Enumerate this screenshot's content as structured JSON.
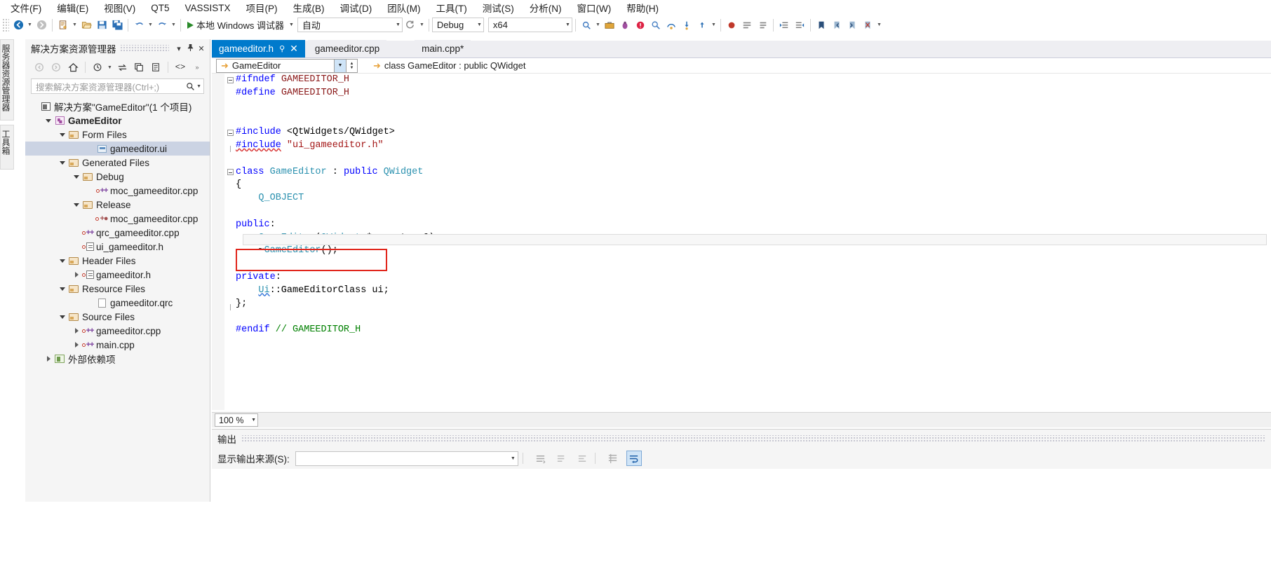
{
  "menubar": {
    "items": [
      {
        "label": "文件(F)"
      },
      {
        "label": "编辑(E)"
      },
      {
        "label": "视图(V)"
      },
      {
        "label": "QT5"
      },
      {
        "label": "VASSISTX"
      },
      {
        "label": "项目(P)"
      },
      {
        "label": "生成(B)"
      },
      {
        "label": "调试(D)"
      },
      {
        "label": "团队(M)"
      },
      {
        "label": "工具(T)"
      },
      {
        "label": "测试(S)"
      },
      {
        "label": "分析(N)"
      },
      {
        "label": "窗口(W)"
      },
      {
        "label": "帮助(H)"
      }
    ]
  },
  "toolbar": {
    "back_icon": "back-arrow-icon",
    "forward_icon": "forward-arrow-icon",
    "new_project_icon": "new-project-icon",
    "open_file_icon": "open-file-icon",
    "save_icon": "save-icon",
    "save_all_icon": "save-all-icon",
    "undo_icon": "undo-icon",
    "redo_icon": "redo-icon",
    "run_label": "本地 Windows 调试器",
    "run_icon": "play-icon",
    "config_auto": "自动",
    "restart_icon": "restart-icon",
    "config_debug": "Debug",
    "config_platform": "x64",
    "right_icons": [
      "find-icon",
      "toolbox-icon",
      "bug-icon",
      "error-list-icon",
      "find-in-files-icon",
      "step-over-icon",
      "step-into-icon",
      "step-out-icon",
      "breakpoint-icon",
      "comment-icon",
      "uncomment-icon",
      "indent-icon",
      "outdent-icon",
      "bookmark-icon",
      "prev-bookmark-icon",
      "next-bookmark-icon",
      "clear-bookmarks-icon"
    ]
  },
  "left_vertical_tabs": [
    {
      "label": "服务器资源管理器"
    },
    {
      "label": "工具箱"
    }
  ],
  "solution_explorer": {
    "title": "解决方案资源管理器",
    "header_buttons": [
      {
        "name": "dropdown-icon",
        "glyph": "▾"
      },
      {
        "name": "pin-icon",
        "glyph": "⚲"
      },
      {
        "name": "close-icon",
        "glyph": "✕"
      }
    ],
    "toolbar_icons": [
      {
        "name": "back-icon",
        "glyph": "↺"
      },
      {
        "name": "forward-icon",
        "glyph": "↻"
      },
      {
        "name": "home-icon",
        "glyph": "⌂"
      },
      {
        "name": "pending-changes-icon",
        "glyph": "◷"
      },
      {
        "name": "sync-icon",
        "glyph": "⇄"
      },
      {
        "name": "collapse-all-icon",
        "glyph": "❐"
      },
      {
        "name": "properties-icon",
        "glyph": "▤"
      },
      {
        "name": "show-all-files-icon",
        "glyph": "<>"
      }
    ],
    "search_placeholder": "搜索解决方案资源管理器(Ctrl+;)",
    "search_icon": "magnifier-icon",
    "tree": [
      {
        "label": "解决方案\"GameEditor\"(1 个项目)",
        "indent": 0,
        "twisty": "none",
        "icon": "solution-icon",
        "bold": false,
        "selected": false
      },
      {
        "label": "GameEditor",
        "indent": 1,
        "twisty": "down",
        "icon": "project-icon",
        "bold": true,
        "selected": false
      },
      {
        "label": "Form Files",
        "indent": 2,
        "twisty": "down",
        "icon": "folder-icon",
        "bold": false,
        "selected": false
      },
      {
        "label": "gameeditor.ui",
        "indent": 4,
        "twisty": "none",
        "icon": "ui-file-icon",
        "bold": false,
        "selected": true
      },
      {
        "label": "Generated Files",
        "indent": 2,
        "twisty": "down",
        "icon": "folder-icon",
        "bold": false,
        "selected": false
      },
      {
        "label": "Debug",
        "indent": 3,
        "twisty": "down",
        "icon": "folder-icon",
        "bold": false,
        "selected": false
      },
      {
        "label": "moc_gameeditor.cpp",
        "indent": 4,
        "twisty": "none",
        "icon": "cpp-file-icon",
        "bold": false,
        "selected": false
      },
      {
        "label": "Release",
        "indent": 3,
        "twisty": "down",
        "icon": "folder-icon",
        "bold": false,
        "selected": false
      },
      {
        "label": "moc_gameeditor.cpp",
        "indent": 4,
        "twisty": "none",
        "icon": "cpp-file-excluded-icon",
        "bold": false,
        "selected": false
      },
      {
        "label": "qrc_gameeditor.cpp",
        "indent": 3,
        "twisty": "none",
        "icon": "cpp-file-icon",
        "bold": false,
        "selected": false
      },
      {
        "label": "ui_gameeditor.h",
        "indent": 3,
        "twisty": "none",
        "icon": "header-file-icon",
        "bold": false,
        "selected": false
      },
      {
        "label": "Header Files",
        "indent": 2,
        "twisty": "down",
        "icon": "folder-icon",
        "bold": false,
        "selected": false
      },
      {
        "label": "gameeditor.h",
        "indent": 3,
        "twisty": "right",
        "icon": "header-file-icon",
        "bold": false,
        "selected": false
      },
      {
        "label": "Resource Files",
        "indent": 2,
        "twisty": "down",
        "icon": "folder-icon",
        "bold": false,
        "selected": false
      },
      {
        "label": "gameeditor.qrc",
        "indent": 4,
        "twisty": "none",
        "icon": "blank-file-icon",
        "bold": false,
        "selected": false
      },
      {
        "label": "Source Files",
        "indent": 2,
        "twisty": "down",
        "icon": "folder-icon",
        "bold": false,
        "selected": false
      },
      {
        "label": "gameeditor.cpp",
        "indent": 3,
        "twisty": "right",
        "icon": "cpp-file-icon",
        "bold": false,
        "selected": false
      },
      {
        "label": "main.cpp",
        "indent": 3,
        "twisty": "right",
        "icon": "cpp-file-icon",
        "bold": false,
        "selected": false
      },
      {
        "label": "外部依赖项",
        "indent": 1,
        "twisty": "right",
        "icon": "external-deps-icon",
        "bold": false,
        "selected": false
      }
    ]
  },
  "editor": {
    "tabs": [
      {
        "label": "gameeditor.h",
        "active": true,
        "pin_icon": "pin-icon",
        "close_icon": "close-icon"
      },
      {
        "label": "gameeditor.cpp",
        "active": false
      },
      {
        "label": "main.cpp*",
        "active": false
      }
    ],
    "nav_left": "GameEditor",
    "nav_right": "class GameEditor : public QWidget",
    "nav_arrow_icon": "orange-arrow-icon",
    "zoom_level": "100 %",
    "annotation": {
      "type": "red-rectangle",
      "color": "#e1251b"
    },
    "code_lines": [
      {
        "fold": "box",
        "tokens": [
          {
            "t": "#ifndef ",
            "c": "pp"
          },
          {
            "t": "GAMEEDITOR_H",
            "c": "macro"
          }
        ]
      },
      {
        "fold": "bar",
        "tokens": [
          {
            "t": "#define ",
            "c": "pp"
          },
          {
            "t": "GAMEEDITOR_H",
            "c": "macro"
          }
        ]
      },
      {
        "fold": "bar",
        "tokens": []
      },
      {
        "fold": "bar",
        "tokens": []
      },
      {
        "fold": "box",
        "tokens": [
          {
            "t": "#include ",
            "c": "pp"
          },
          {
            "t": "<QtWidgets/QWidget>",
            "c": "plain"
          }
        ]
      },
      {
        "fold": "barend",
        "tokens": [
          {
            "t": "#include",
            "c": "pp-squiggle"
          },
          {
            "t": " ",
            "c": "plain"
          },
          {
            "t": "\"ui_gameeditor.h\"",
            "c": "str"
          }
        ]
      },
      {
        "fold": "none",
        "tokens": []
      },
      {
        "fold": "box",
        "tokens": [
          {
            "t": "class ",
            "c": "kw"
          },
          {
            "t": "GameEditor",
            "c": "type"
          },
          {
            "t": " : ",
            "c": "plain"
          },
          {
            "t": "public ",
            "c": "kw"
          },
          {
            "t": "QWidget",
            "c": "type"
          }
        ]
      },
      {
        "fold": "bar",
        "tokens": [
          {
            "t": "{",
            "c": "plain"
          }
        ]
      },
      {
        "fold": "bar",
        "tokens": [
          {
            "t": "    ",
            "c": "plain"
          },
          {
            "t": "Q_OBJECT",
            "c": "type"
          }
        ]
      },
      {
        "fold": "bar",
        "tokens": []
      },
      {
        "fold": "bar",
        "tokens": [
          {
            "t": "public",
            "c": "kw"
          },
          {
            "t": ":",
            "c": "plain"
          }
        ]
      },
      {
        "fold": "bar",
        "tokens": [
          {
            "t": "    ",
            "c": "plain"
          },
          {
            "t": "GameEditor",
            "c": "type"
          },
          {
            "t": "(",
            "c": "plain"
          },
          {
            "t": "QWidget",
            "c": "type"
          },
          {
            "t": " *parent = ",
            "c": "plain"
          },
          {
            "t": "0",
            "c": "num"
          },
          {
            "t": ");",
            "c": "plain"
          }
        ]
      },
      {
        "fold": "bar",
        "tokens": [
          {
            "t": "    ~",
            "c": "plain"
          },
          {
            "t": "GameEditor",
            "c": "type"
          },
          {
            "t": "();",
            "c": "plain"
          }
        ]
      },
      {
        "fold": "bar",
        "tokens": []
      },
      {
        "fold": "bar",
        "tokens": [
          {
            "t": "private",
            "c": "kw"
          },
          {
            "t": ":",
            "c": "plain"
          }
        ]
      },
      {
        "fold": "bar",
        "tokens": [
          {
            "t": "    ",
            "c": "plain"
          },
          {
            "t": "Ui",
            "c": "type-squiggle"
          },
          {
            "t": "::GameEditorClass ui;",
            "c": "plain"
          }
        ]
      },
      {
        "fold": "barend",
        "tokens": [
          {
            "t": "};",
            "c": "plain"
          }
        ]
      },
      {
        "fold": "none",
        "tokens": []
      },
      {
        "fold": "none",
        "tokens": [
          {
            "t": "#endif ",
            "c": "pp"
          },
          {
            "t": "// GAMEEDITOR_H",
            "c": "cmt"
          }
        ]
      }
    ]
  },
  "output_panel": {
    "title": "输出",
    "source_label": "显示输出来源(S):",
    "source_value": "",
    "source_dropdown_icon": "chevron-down-icon",
    "toolbar_icons": [
      {
        "name": "list-output-icon",
        "glyph": "≡",
        "active": false
      },
      {
        "name": "clear-all-icon",
        "glyph": "✑",
        "active": false
      },
      {
        "name": "toggle-wordwrap-icon",
        "glyph": "⇲",
        "active": false
      },
      {
        "name": "find-message-icon",
        "glyph": "☰",
        "active": false
      },
      {
        "name": "wrap-long-lines-icon",
        "glyph": "↵",
        "active": true
      }
    ],
    "header_buttons": [
      {
        "name": "dropdown-icon",
        "glyph": "▾"
      },
      {
        "name": "pin-icon",
        "glyph": "⚲"
      },
      {
        "name": "close-icon",
        "glyph": "✕"
      }
    ]
  },
  "colors": {
    "active_tab_bg": "#007acc",
    "annotation_red": "#e1251b",
    "selection_blue": "#cbd3e3",
    "keyword_blue": "#0000ff",
    "type_teal": "#2b91af",
    "macro_maroon": "#8b1a1a",
    "string_red": "#a31515",
    "comment_green": "#008000"
  }
}
